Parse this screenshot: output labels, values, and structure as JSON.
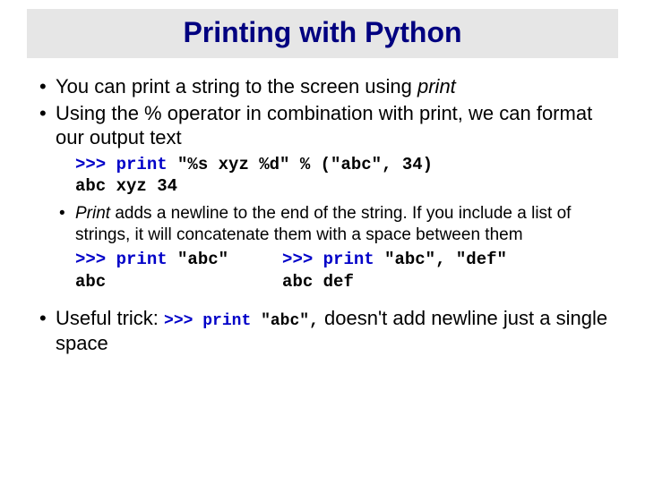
{
  "title": "Printing with Python",
  "bullet1_a": "You can print a string to the screen using ",
  "bullet1_b": "print",
  "bullet2": "Using the % operator in combination with print, we can format our output text",
  "code1_prompt": ">>> ",
  "code1_kw": "print",
  "code1_rest": "  \"%s xyz %d\"   %   (\"abc\", 34)",
  "code1_out": "abc xyz 34",
  "bullet3_a": "Print",
  "bullet3_b": " adds a newline to the end of the string.  If you include a list of strings, it will concatenate them with a space between them",
  "colA_prompt": ">>> ",
  "colA_kw": "print",
  "colA_rest": " \"abc\"",
  "colA_out": "abc",
  "colB_prompt": ">>> ",
  "colB_kw": "print",
  "colB_rest": " \"abc\", \"def\"",
  "colB_out": "abc def",
  "bullet4_a": "Useful trick: ",
  "bullet4_code_prompt": ">>> ",
  "bullet4_code_kw": "print",
  "bullet4_code_rest": " \"abc\",",
  "bullet4_b": "  doesn't add newline just a single space"
}
